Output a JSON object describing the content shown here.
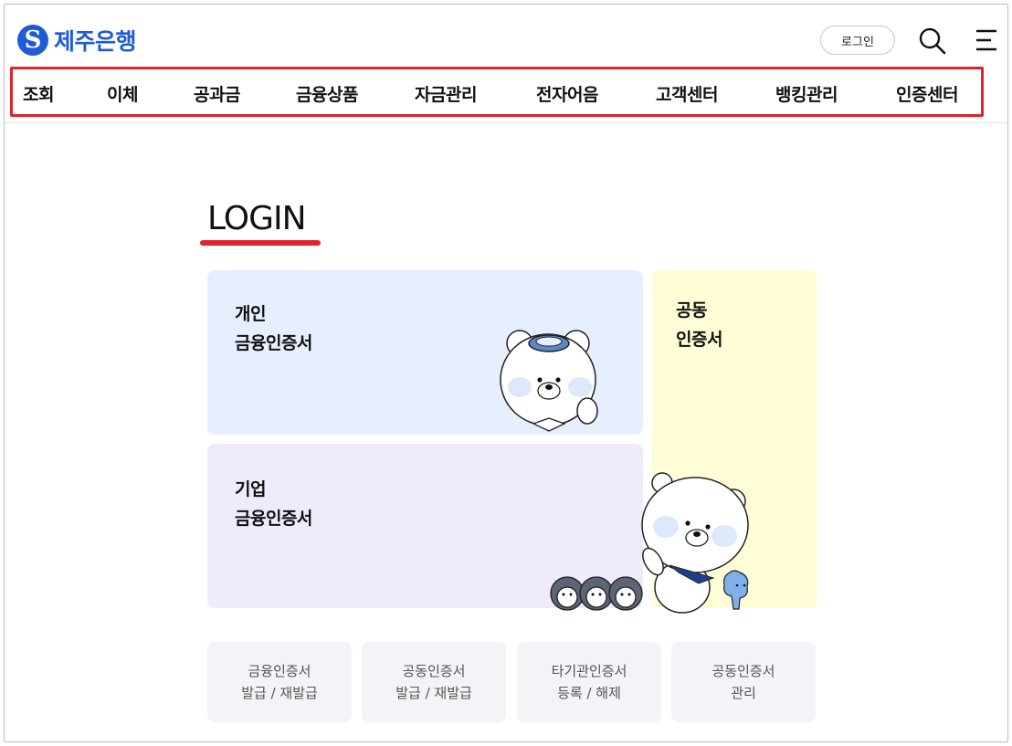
{
  "header": {
    "logo_text": "제주은행",
    "logo_mark": "S",
    "login_label": "로그인",
    "icons": {
      "search": "search-icon",
      "menu": "menu-icon"
    }
  },
  "nav": {
    "items": [
      "조회",
      "이체",
      "공과금",
      "금융상품",
      "자금관리",
      "전자어음",
      "고객센터",
      "뱅킹관리",
      "인증센터"
    ]
  },
  "main": {
    "title": "LOGIN",
    "cards": {
      "personal": {
        "line1": "개인",
        "line2": "금융인증서"
      },
      "corporate": {
        "line1": "기업",
        "line2": "금융인증서"
      },
      "joint": {
        "line1": "공동",
        "line2": "인증서"
      }
    },
    "sub_buttons": [
      {
        "line1": "금융인증서",
        "line2": "발급 / 재발급"
      },
      {
        "line1": "공동인증서",
        "line2": "발급 / 재발급"
      },
      {
        "line1": "타기관인증서",
        "line2": "등록 / 해제"
      },
      {
        "line1": "공동인증서",
        "line2": "관리"
      }
    ]
  },
  "colors": {
    "brand_blue": "#1f5bd6",
    "accent_red": "#e0222b",
    "personal_bg": "#e7eefd",
    "corporate_bg": "#efebfb",
    "joint_bg": "#fefdd6",
    "sub_btn_bg": "#f3f4f7"
  }
}
